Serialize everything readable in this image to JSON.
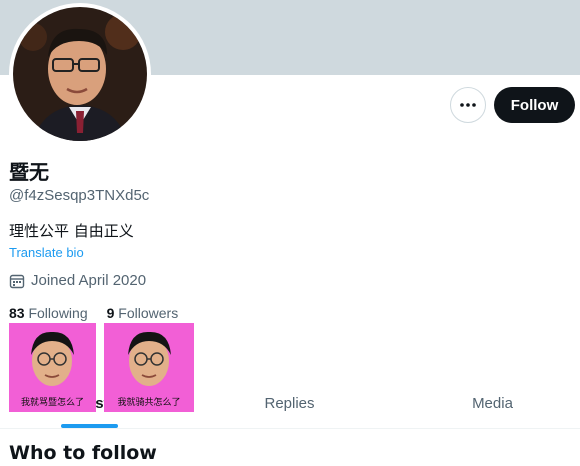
{
  "profile": {
    "display_name": "暨无",
    "handle": "@f4zSesqp3TNXd5c",
    "bio": "理性公平 自由正义",
    "translate_label": "Translate bio",
    "joined": "Joined April 2020"
  },
  "icons": {
    "more": "more-horizontal-icon",
    "calendar": "calendar-icon"
  },
  "actions": {
    "follow_label": "Follow"
  },
  "stats": {
    "following_count": "83",
    "following_label": "Following",
    "followers_count": "9",
    "followers_label": "Followers"
  },
  "tabs": [
    {
      "label": "Posts",
      "active": true
    },
    {
      "label": "Replies",
      "active": false
    },
    {
      "label": "Media",
      "active": false
    }
  ],
  "stickers": [
    {
      "caption": "我就骂暨怎么了"
    },
    {
      "caption": "我就骑共怎么了"
    }
  ],
  "sections": {
    "who_to_follow": "Who to follow"
  },
  "colors": {
    "banner": "#cfd9de",
    "accent": "#1d9bf0",
    "follow_button": "#0f1419",
    "sticker_bg": "#f25fd6"
  }
}
